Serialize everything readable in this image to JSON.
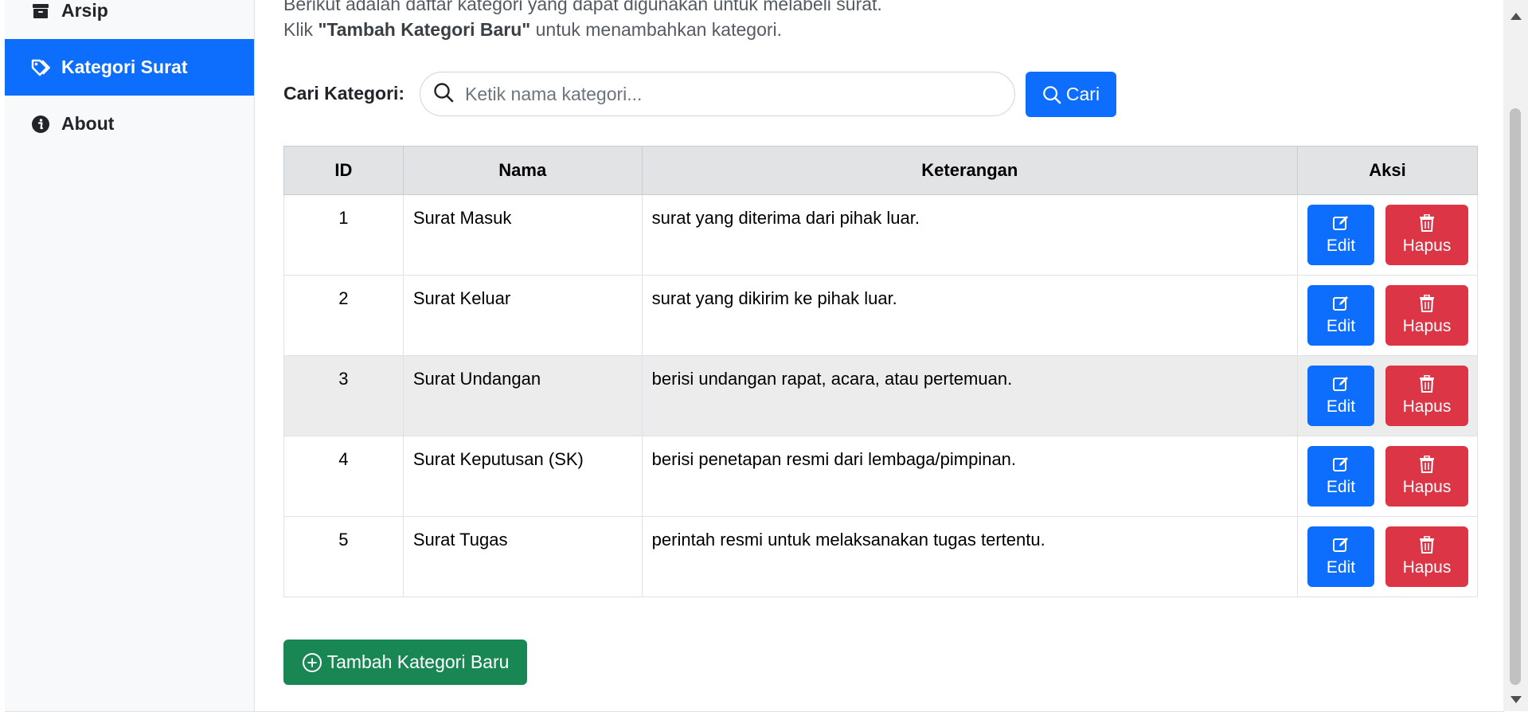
{
  "sidebar": {
    "items": [
      {
        "label": "Arsip",
        "icon": "archive-icon",
        "active": false
      },
      {
        "label": "Kategori Surat",
        "icon": "tag-icon",
        "active": true
      },
      {
        "label": "About",
        "icon": "info-icon",
        "active": false
      }
    ]
  },
  "main": {
    "intro_line1": "Berikut adalah daftar kategori yang dapat digunakan untuk melabeli surat.",
    "intro_line2_pre": "Klik ",
    "intro_line2_bold": "\"Tambah Kategori Baru\"",
    "intro_line2_post": " untuk menambahkan kategori."
  },
  "search": {
    "label": "Cari Kategori:",
    "placeholder": "Ketik nama kategori...",
    "value": "",
    "button_label": "Cari"
  },
  "table": {
    "headers": [
      "ID",
      "Nama",
      "Keterangan",
      "Aksi"
    ],
    "rows": [
      {
        "id": "1",
        "nama": "Surat Masuk",
        "keterangan": "surat yang diterima dari pihak luar."
      },
      {
        "id": "2",
        "nama": "Surat Keluar",
        "keterangan": "surat yang dikirim ke pihak luar."
      },
      {
        "id": "3",
        "nama": "Surat Undangan",
        "keterangan": "berisi undangan rapat, acara, atau pertemuan."
      },
      {
        "id": "4",
        "nama": "Surat Keputusan (SK)",
        "keterangan": "berisi penetapan resmi dari lembaga/pimpinan."
      },
      {
        "id": "5",
        "nama": "Surat Tugas",
        "keterangan": "perintah resmi untuk melaksanakan tugas tertentu."
      }
    ],
    "edit_label": "Edit",
    "delete_label": "Hapus"
  },
  "add_button_label": "Tambah Kategori Baru",
  "colors": {
    "primary": "#0d6efd",
    "danger": "#dc3545",
    "success": "#198754",
    "sidebar_bg": "#f8f9fa",
    "header_bg": "#e2e3e5"
  }
}
